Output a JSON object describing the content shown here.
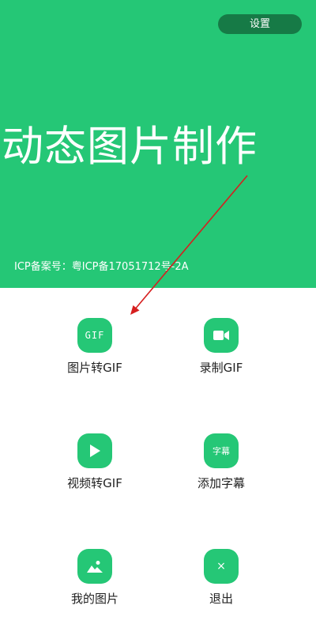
{
  "header": {
    "settings_label": "设置",
    "app_title": "动态图片制作",
    "icp_text": "ICP备案号：粤ICP备17051712号-2A"
  },
  "menu": {
    "image_to_gif": {
      "label": "图片转GIF",
      "icon_text": "GIF"
    },
    "record_gif": {
      "label": "录制GIF"
    },
    "video_to_gif": {
      "label": "视频转GIF"
    },
    "add_subtitle": {
      "label": "添加字幕",
      "icon_text": "字幕"
    },
    "my_images": {
      "label": "我的图片"
    },
    "exit": {
      "label": "退出",
      "icon_text": "×"
    }
  },
  "colors": {
    "brand_green": "#25c776",
    "settings_bg": "#167a46",
    "annotation_arrow": "#d61f1f"
  },
  "icons": {
    "image_to_gif": "gif-icon",
    "record_gif": "video-camera-icon",
    "video_to_gif": "play-icon",
    "add_subtitle": "subtitle-icon",
    "my_images": "image-icon",
    "exit": "close-icon"
  }
}
